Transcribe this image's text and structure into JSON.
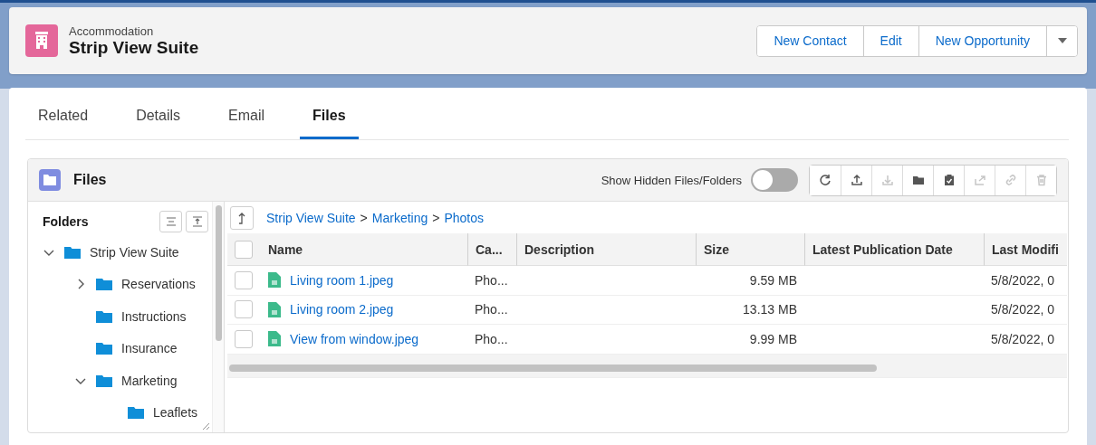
{
  "record": {
    "type_label": "Accommodation",
    "title": "Strip View Suite"
  },
  "actions": [
    {
      "label": "New Contact"
    },
    {
      "label": "Edit"
    },
    {
      "label": "New Opportunity"
    }
  ],
  "tabs": [
    {
      "label": "Related",
      "selected": false
    },
    {
      "label": "Details",
      "selected": false
    },
    {
      "label": "Email",
      "selected": false
    },
    {
      "label": "Files",
      "selected": true
    }
  ],
  "files_panel": {
    "title": "Files",
    "hidden_toggle": {
      "label": "Show Hidden Files/Folders",
      "on": false
    },
    "tools": [
      {
        "kind": "refresh",
        "disabled": false
      },
      {
        "kind": "upload",
        "disabled": false
      },
      {
        "kind": "download",
        "disabled": true
      },
      {
        "kind": "folder",
        "disabled": false
      },
      {
        "kind": "clipboard",
        "disabled": false
      },
      {
        "kind": "share",
        "disabled": true
      },
      {
        "kind": "link",
        "disabled": true
      },
      {
        "kind": "trash",
        "disabled": true
      }
    ],
    "folders": {
      "title": "Folders",
      "tree": [
        {
          "label": "Strip View Suite",
          "expanded": true,
          "children": [
            {
              "label": "Reservations",
              "expanded": false
            },
            {
              "label": "Instructions"
            },
            {
              "label": "Insurance"
            },
            {
              "label": "Marketing",
              "expanded": true,
              "children": [
                {
                  "label": "Leaflets"
                }
              ]
            }
          ]
        }
      ]
    },
    "breadcrumb": [
      "Strip View Suite",
      "Marketing",
      "Photos"
    ],
    "breadcrumb_separator": ">",
    "table": {
      "all_checked": false,
      "columns": [
        "Name",
        "Ca...",
        "Description",
        "Size",
        "Latest Publication Date",
        "Last Modifi"
      ],
      "rows": [
        {
          "checked": false,
          "name": "Living room 1.jpeg",
          "category": "Pho...",
          "size": "9.59 MB",
          "modified": "5/8/2022, 0"
        },
        {
          "checked": false,
          "name": "Living room 2.jpeg",
          "category": "Pho...",
          "size": "13.13 MB",
          "modified": "5/8/2022, 0"
        },
        {
          "checked": false,
          "name": "View from window.jpeg",
          "category": "Pho...",
          "size": "9.99 MB",
          "modified": "5/8/2022, 0"
        }
      ]
    }
  }
}
